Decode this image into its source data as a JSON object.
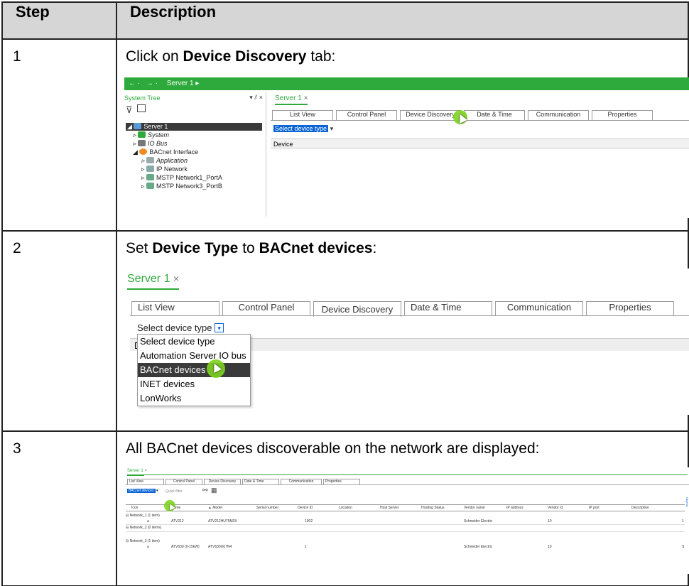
{
  "header": {
    "step": "Step",
    "description": "Description"
  },
  "rows": [
    {
      "number": "1",
      "before": "Click on ",
      "bold": "Device Discovery",
      "after": " tab:"
    },
    {
      "number": "2",
      "before": "Set ",
      "bold": "Device Type",
      "mid": " to ",
      "bold2": "BACnet devices",
      "after": ":"
    },
    {
      "number": "3",
      "text": "All BACnet devices discoverable on the network are displayed:"
    }
  ],
  "shot1": {
    "titlebar": "Server 1 ▸",
    "tree_title": "System Tree",
    "tree_controls": "▾ ⫽ ×",
    "tree": [
      "Server 1",
      "System",
      "IO Bus",
      "BACnet Interface",
      "Application",
      "IP Network",
      "MSTP Network1_PortA",
      "MSTP Network3_PortB"
    ],
    "doc_tab": "Server 1",
    "tabs": [
      "List View",
      "Control Panel",
      "Device Discovery",
      "Date & Time",
      "Communication",
      "Properties"
    ],
    "select": "Select device type",
    "column": "Device"
  },
  "shot2": {
    "doc_tab": "Server 1",
    "tabs": [
      "List View",
      "Control Panel",
      "Device Discovery",
      "Date & Time",
      "Communication",
      "Properties"
    ],
    "select": "Select device type",
    "options": [
      "Select device type",
      "Automation Server IO bus",
      "BACnet devices",
      "INET devices",
      "LonWorks"
    ],
    "col_stub": "D"
  },
  "shot3": {
    "doc_tab": "Server 1",
    "tabs": [
      "List View",
      "Control Panel",
      "Device Discovery",
      "Date & Time",
      "Communication",
      "Properties"
    ],
    "select": "BACnet devices",
    "quick_filter": "Quick filter",
    "columns": [
      "Icon",
      "Name",
      "▲ Model",
      "Serial number",
      "Device ID",
      "Location",
      "Host Server",
      "Hosting Status",
      "Vendor name",
      "IP address",
      "Vendor id",
      "IP port",
      "Description"
    ],
    "side_label": "Objects",
    "groups": [
      {
        "label": "⊟ Network_1 (1 item)",
        "row": {
          "name": "ATV212",
          "model": "ATV212HU75M3X",
          "device_id": "1002",
          "vendor": "Schneider Electric",
          "vendor_id": "10",
          "end": "1"
        }
      },
      {
        "label": "⊟ Network_2 (0 items)"
      },
      {
        "label": "⊟ Network_3 (1 item)",
        "row": {
          "name": "ATV630 (0-15kW)",
          "model": "ATV630U07N4",
          "device_id": "1",
          "vendor": "Schneider Electric",
          "vendor_id": "10",
          "end": "S"
        }
      }
    ]
  },
  "colors": {
    "green": "#2eaa3c",
    "header_bg": "#d6d6d6",
    "highlight": "#0a64d6"
  }
}
